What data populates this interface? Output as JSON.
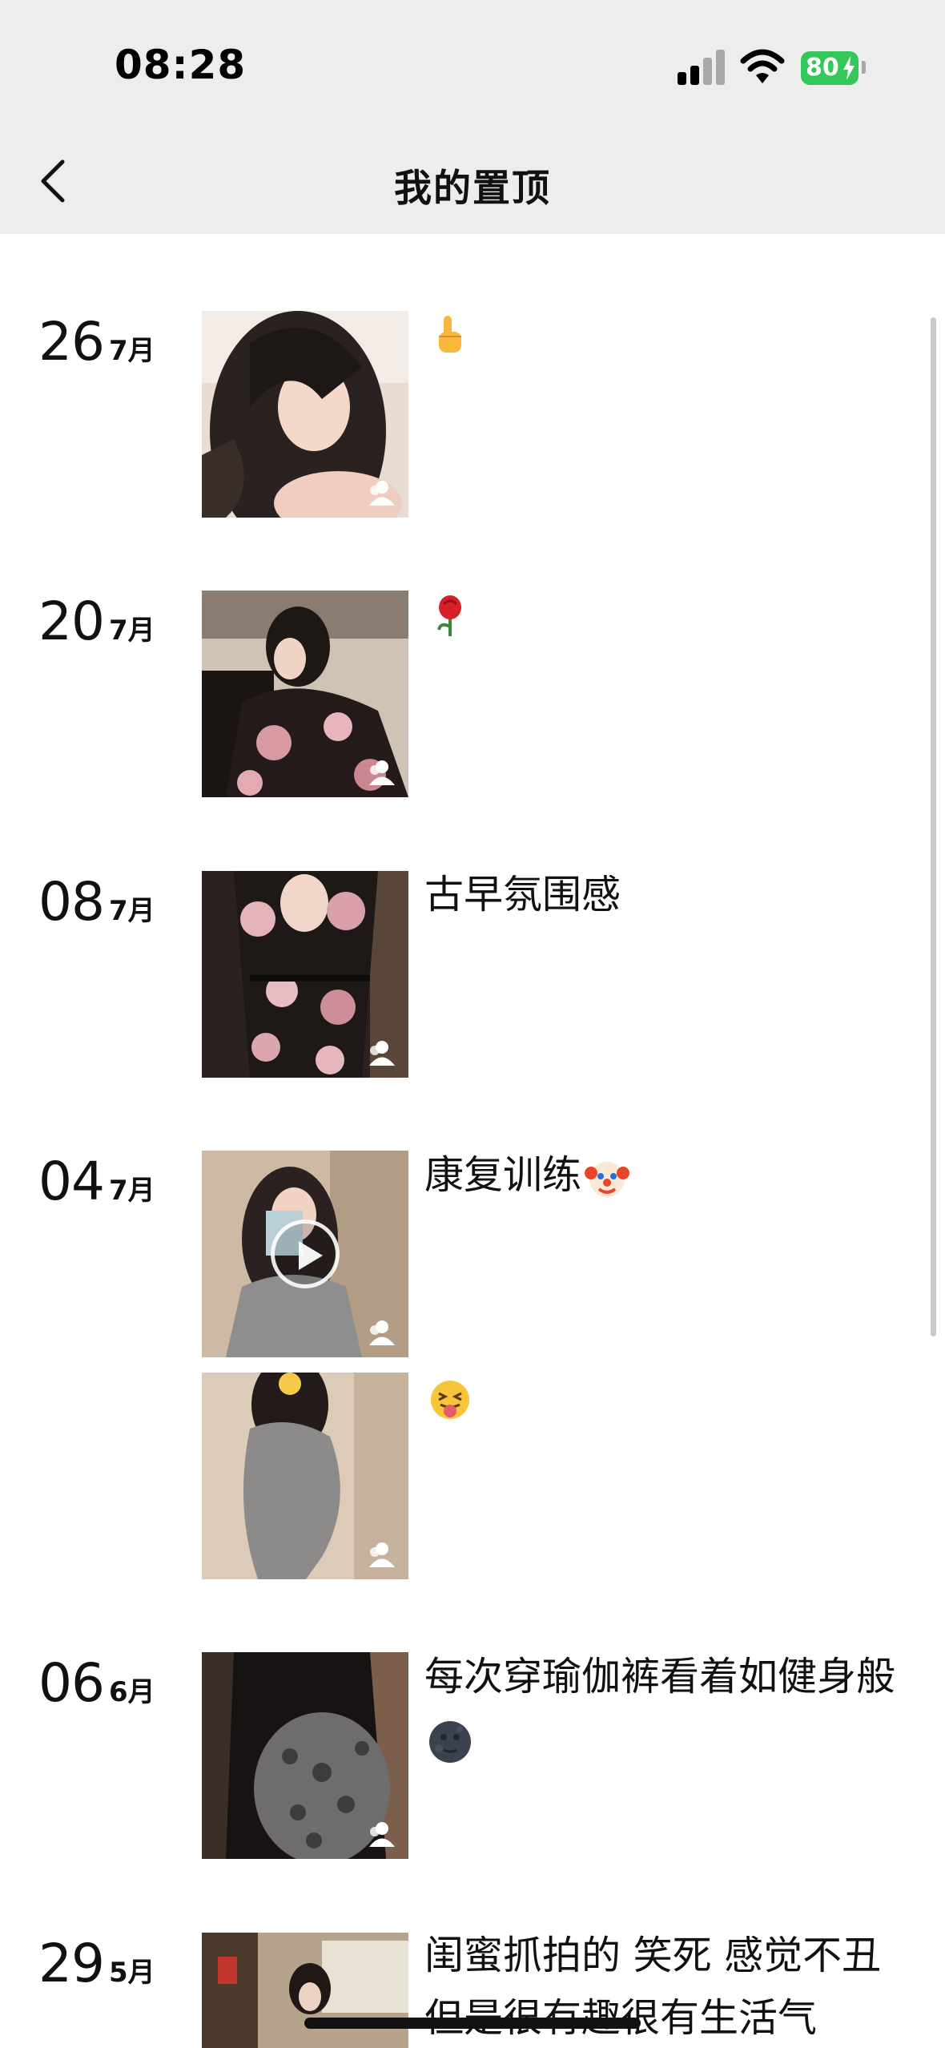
{
  "status_bar": {
    "time": "08:28",
    "battery": "80",
    "icons": [
      "cellular-signal-icon",
      "wifi-icon",
      "battery-charging-icon"
    ],
    "battery_color": "#34c759"
  },
  "nav": {
    "title": "我的置顶",
    "back_icon": "chevron-left-icon"
  },
  "colors": {
    "header_bg": "#ededed",
    "page_bg": "#ffffff",
    "text": "#111111"
  },
  "posts": [
    {
      "day": "26",
      "month": "7月",
      "entries": [
        {
          "caption": "",
          "emoji": "pointing-up-emoji",
          "is_video": false
        }
      ]
    },
    {
      "day": "20",
      "month": "7月",
      "entries": [
        {
          "caption": "",
          "emoji": "rose-emoji",
          "is_video": false
        }
      ]
    },
    {
      "day": "08",
      "month": "7月",
      "entries": [
        {
          "caption": "古早氛围感",
          "emoji": "",
          "is_video": false
        }
      ]
    },
    {
      "day": "04",
      "month": "7月",
      "entries": [
        {
          "caption": "康复训练",
          "emoji": "clown-face-emoji",
          "is_video": true
        },
        {
          "caption": "",
          "emoji": "squinting-tongue-emoji",
          "is_video": false
        }
      ]
    },
    {
      "day": "06",
      "month": "6月",
      "entries": [
        {
          "caption": "每次穿瑜伽裤看着如健身般",
          "emoji": "new-moon-face-emoji",
          "is_video": false
        }
      ]
    },
    {
      "day": "29",
      "month": "5月",
      "entries": [
        {
          "caption": "闺蜜抓拍的 笑死 感觉不丑但是很有趣很有生活气",
          "emoji": "",
          "is_video": false
        }
      ]
    }
  ],
  "thumbnail_visibility_icon": "friends-visibility-icon"
}
